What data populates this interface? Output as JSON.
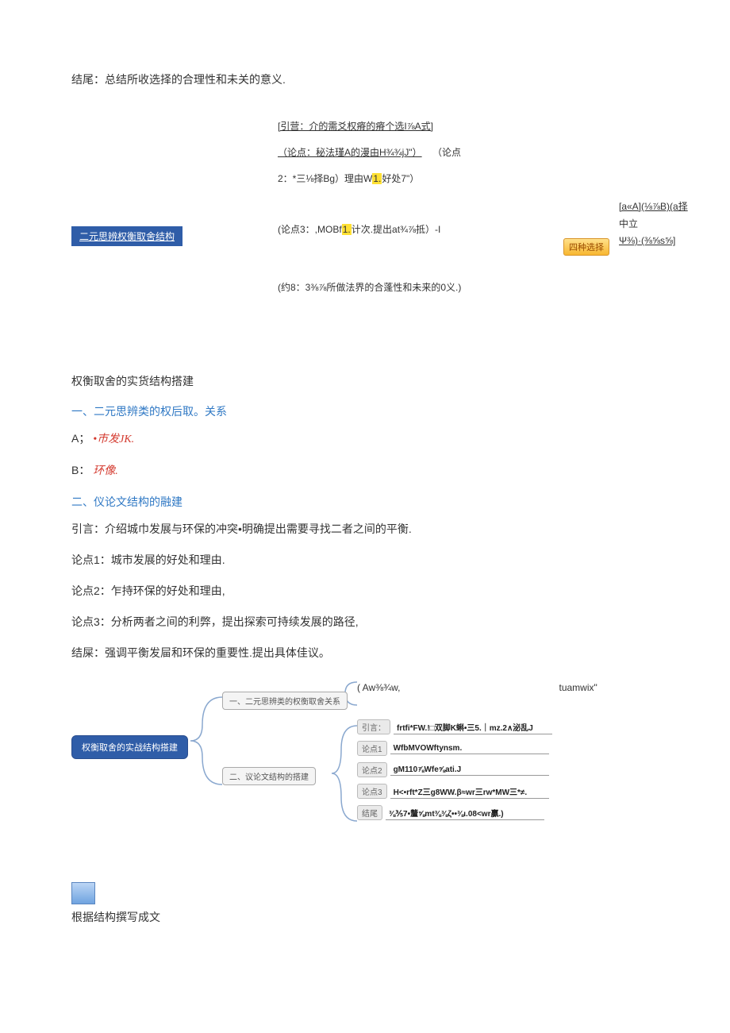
{
  "conclusion": "结尾：总结所收选择的合理性和未关的意义.",
  "diagram": {
    "row1": "[引营：介的需爻权瘠的瘠个选I⅞A式]",
    "row2a": "（论点：秘法瑾A的漫由H¾¾jJ\"）",
    "row2b": "（论点",
    "row3a": "2：*三⅛择Bg）理由W",
    "row3hl": "1.",
    "row3b": "好处7\"）",
    "row4a": "(论点3：,MOBf",
    "row4hl": "1.",
    "row4b": "计次.提出at¾⅞抵）-I",
    "row5": "(约8：3⅜⅞所做法界的合蓬性和未来的0义.)",
    "blue_tag": "二元思辨权衡取舍结构",
    "orange_tag": "四种选择",
    "right1": "[a«A](⅛⅞B)(a择",
    "right2": "中立",
    "right3": "Ψ⅜)·(⅜⅝s⅝]"
  },
  "section1_title": "权衡取舍的实货结构搭建",
  "h_one": "一、二元思辨类的权后取。关系",
  "A_label": "A；",
  "A_value": "•巿发JK.",
  "B_label": "B：",
  "B_value": "环像.",
  "h_two": "二、仪论文结构的融建",
  "p_intro": "引言：介绍城巾发展与环保的冲突•明确提出需要寻找二者之间的平衡.",
  "p_pt1": "论点1：城市发展的好处和理由.",
  "p_pt2": "论点2：乍持环保的好处和理由,",
  "p_pt3": "论点3：分析两者之间的利弊，提出探索可持续发展的路径,",
  "p_end": "结屎：强调平衡发屇和环保的重要性.提出具体佳议。",
  "mindmap": {
    "root": "权衡取舍的实战结构搭建",
    "branch1": "一、二元思辨类的权衡取舍关系",
    "branch2": "二、议论文结构的搭建",
    "top_right_a": "( Aw⅜¾w,",
    "top_right_b": "tuamwix\"",
    "leaves": [
      {
        "tag": "引言：",
        "text": "frtfi*FW.!□双脚K蝌•三5.｜mz.2∧泌乱J"
      },
      {
        "tag": "论点1",
        "text": "WfbMVOWftynsm."
      },
      {
        "tag": "论点2",
        "text": "gM110⅞Wfe⅝ati.J"
      },
      {
        "tag": "论点3",
        "text": "H<•rft*Z三g8WW.β≈wr三rw*MW三*≠."
      },
      {
        "tag": "结尾",
        "text": "⅜⅗7•釐⅝mt⅜⅜ζ••⅜ι.08<wr贏.)"
      }
    ]
  },
  "footer_text": "根据结构撰写成文"
}
